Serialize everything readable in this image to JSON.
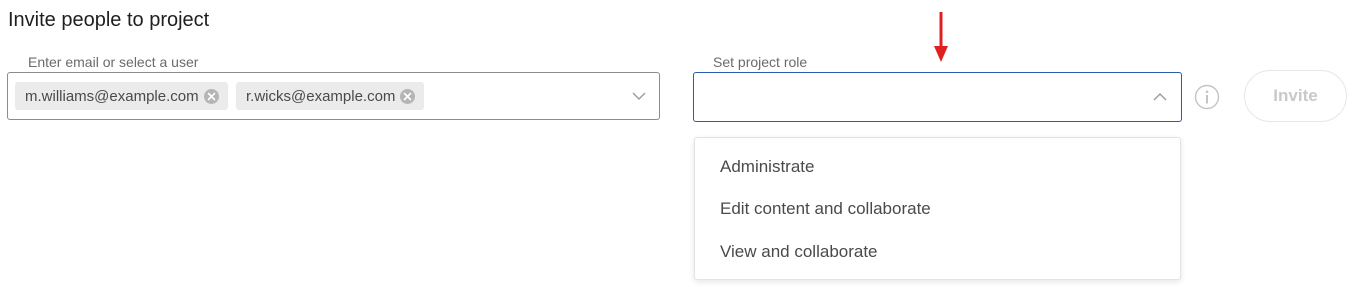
{
  "dialog": {
    "title": "Invite people to project"
  },
  "users_field": {
    "label": "Enter email or select a user",
    "chips": [
      {
        "email": "m.williams@example.com"
      },
      {
        "email": "r.wicks@example.com"
      }
    ],
    "dropdown_icon": "chevron-down-icon"
  },
  "role_field": {
    "label": "Set project role",
    "value": "",
    "dropdown_icon": "chevron-up-icon",
    "options": [
      {
        "label": "Administrate"
      },
      {
        "label": "Edit content and collaborate"
      },
      {
        "label": "View and collaborate"
      }
    ]
  },
  "info_icon": "info-icon",
  "invite_button": {
    "label": "Invite",
    "enabled": false
  },
  "annotation": {
    "icon": "arrow-down-icon",
    "color": "#e02020"
  }
}
